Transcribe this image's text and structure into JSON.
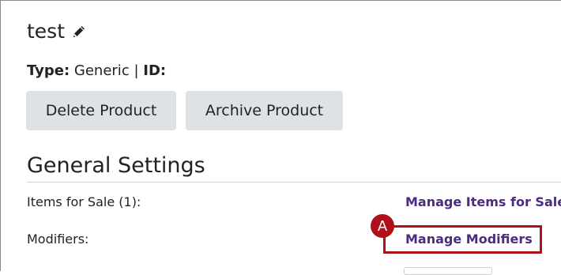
{
  "product": {
    "title": "test",
    "edit_icon": "pencil-icon",
    "type_label": "Type:",
    "type_value": "Generic",
    "separator": "|",
    "id_label": "ID:"
  },
  "actions": {
    "delete_label": "Delete Product",
    "archive_label": "Archive Product"
  },
  "general_settings": {
    "heading": "General Settings",
    "rows": [
      {
        "label": "Items for Sale (1):",
        "link": "Manage Items for Sale"
      },
      {
        "label": "Modifiers:",
        "link": "Manage Modifiers"
      }
    ]
  },
  "annotation": {
    "marker": "A",
    "color": "#b0101a"
  },
  "colors": {
    "link": "#4b2c7f",
    "button_bg": "#dfe2e5"
  }
}
